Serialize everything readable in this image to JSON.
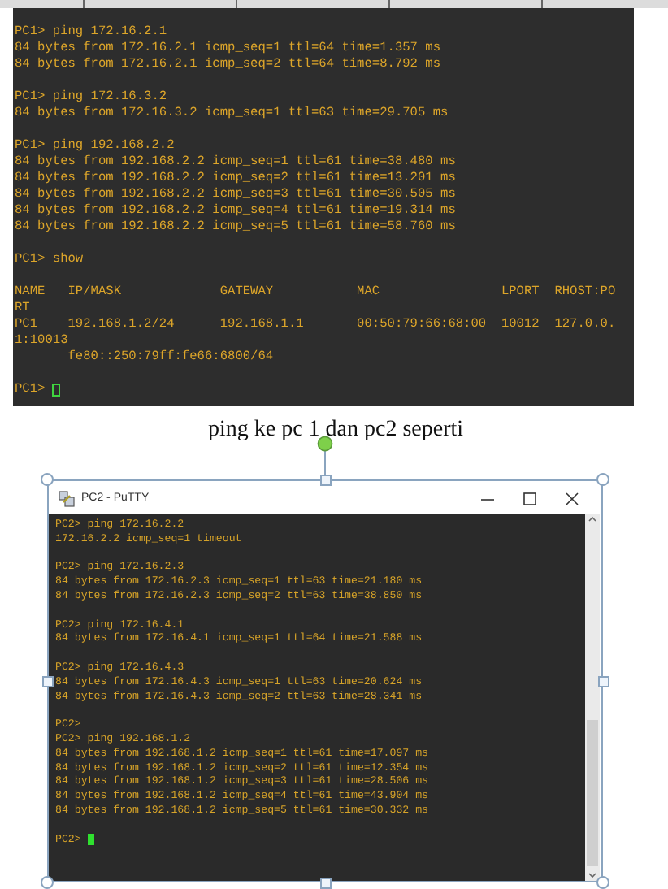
{
  "terminal_1": {
    "focused": false,
    "prompt": "PC1>",
    "blocks": [
      [
        "PC1> ping 172.16.2.1",
        "84 bytes from 172.16.2.1 icmp_seq=1 ttl=64 time=1.357 ms",
        "84 bytes from 172.16.2.1 icmp_seq=2 ttl=64 time=8.792 ms"
      ],
      [
        "PC1> ping 172.16.3.2",
        "84 bytes from 172.16.3.2 icmp_seq=1 ttl=63 time=29.705 ms"
      ],
      [
        "PC1> ping 192.168.2.2",
        "84 bytes from 192.168.2.2 icmp_seq=1 ttl=61 time=38.480 ms",
        "84 bytes from 192.168.2.2 icmp_seq=2 ttl=61 time=13.201 ms",
        "84 bytes from 192.168.2.2 icmp_seq=3 ttl=61 time=30.505 ms",
        "84 bytes from 192.168.2.2 icmp_seq=4 ttl=61 time=19.314 ms",
        "84 bytes from 192.168.2.2 icmp_seq=5 ttl=61 time=58.760 ms"
      ],
      [
        "PC1> show"
      ],
      [
        "NAME   IP/MASK             GATEWAY           MAC                LPORT  RHOST:PO",
        "RT",
        "PC1    192.168.1.2/24      192.168.1.1       00:50:79:66:68:00  10012  127.0.0.",
        "1:10013",
        "       fe80::250:79ff:fe66:6800/64"
      ]
    ]
  },
  "caption": "ping ke pc 1 dan pc2 seperti",
  "putty_image": {
    "selected": true,
    "window": {
      "title": "PC2 - PuTTY"
    },
    "terminal": {
      "focused": true,
      "prompt": "PC2>",
      "blocks": [
        [
          "PC2> ping 172.16.2.2",
          "172.16.2.2 icmp_seq=1 timeout"
        ],
        [
          "PC2> ping 172.16.2.3",
          "84 bytes from 172.16.2.3 icmp_seq=1 ttl=63 time=21.180 ms",
          "84 bytes from 172.16.2.3 icmp_seq=2 ttl=63 time=38.850 ms"
        ],
        [
          "PC2> ping 172.16.4.1",
          "84 bytes from 172.16.4.1 icmp_seq=1 ttl=64 time=21.588 ms"
        ],
        [
          "PC2> ping 172.16.4.3",
          "84 bytes from 172.16.4.3 icmp_seq=1 ttl=63 time=20.624 ms",
          "84 bytes from 172.16.4.3 icmp_seq=2 ttl=63 time=28.341 ms"
        ],
        [
          "PC2>",
          "PC2> ping 192.168.1.2",
          "84 bytes from 192.168.1.2 icmp_seq=1 ttl=61 time=17.097 ms",
          "84 bytes from 192.168.1.2 icmp_seq=2 ttl=61 time=12.354 ms",
          "84 bytes from 192.168.1.2 icmp_seq=3 ttl=61 time=28.506 ms",
          "84 bytes from 192.168.1.2 icmp_seq=4 ttl=61 time=43.904 ms",
          "84 bytes from 192.168.1.2 icmp_seq=5 ttl=61 time=30.332 ms"
        ]
      ]
    }
  }
}
